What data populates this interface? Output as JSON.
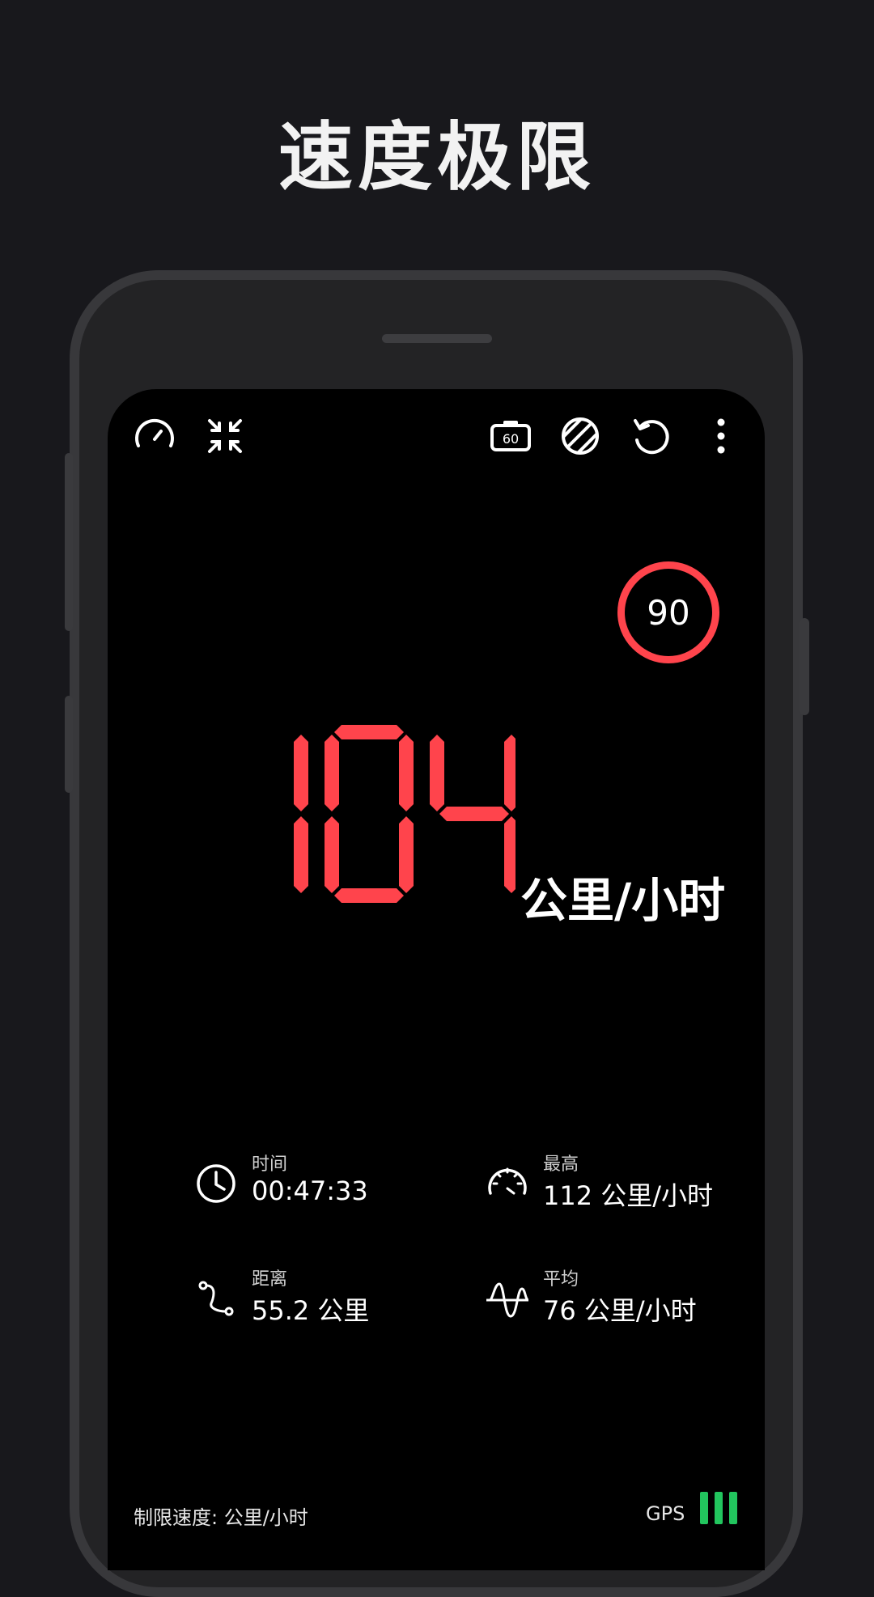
{
  "headline": "速度极限",
  "toolbar": {
    "left_icons": [
      "speedometer-icon",
      "compress-icon"
    ],
    "right_icons": [
      "speed-camera-icon",
      "theme-icon",
      "reset-icon",
      "more-vert-icon"
    ]
  },
  "speed_limit": "90",
  "speed": {
    "value": "104",
    "unit": "公里/小时",
    "color": "#ff444c"
  },
  "stats": [
    {
      "icon": "clock-icon",
      "label": "时间",
      "value": "00:47:33"
    },
    {
      "icon": "gauge-icon",
      "label": "最高",
      "value": "112 公里/小时"
    },
    {
      "icon": "route-icon",
      "label": "距离",
      "value": "55.2 公里"
    },
    {
      "icon": "wave-icon",
      "label": "平均",
      "value": "76 公里/小时"
    }
  ],
  "footer": {
    "limit_text": "制限速度: 公里/小时",
    "gps_label": "GPS",
    "gps_color": "#22c55e"
  }
}
